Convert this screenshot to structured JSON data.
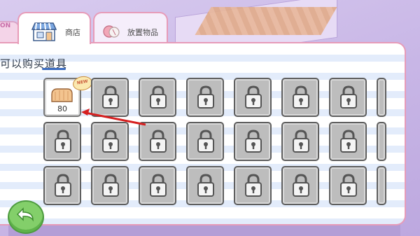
{
  "tabs": [
    {
      "label": "商店",
      "icon": "shop-stall-icon",
      "active": true
    },
    {
      "label": "放置物品",
      "icon": "place-items-icon",
      "active": false
    }
  ],
  "panel": {
    "title": "可以购买道具"
  },
  "items": [
    {
      "state": "unlocked",
      "icon": "bread-icon",
      "price": "80",
      "badge": "NEW"
    },
    {
      "state": "locked"
    },
    {
      "state": "locked"
    },
    {
      "state": "locked"
    },
    {
      "state": "locked"
    },
    {
      "state": "locked"
    },
    {
      "state": "locked"
    },
    {
      "state": "locked"
    },
    {
      "state": "locked"
    },
    {
      "state": "locked"
    },
    {
      "state": "locked"
    },
    {
      "state": "locked"
    },
    {
      "state": "locked"
    },
    {
      "state": "locked"
    },
    {
      "state": "locked"
    },
    {
      "state": "locked"
    },
    {
      "state": "locked"
    },
    {
      "state": "locked"
    },
    {
      "state": "locked"
    },
    {
      "state": "locked"
    },
    {
      "state": "locked"
    }
  ],
  "colors": {
    "accent_border": "#e79bb8",
    "locked_slot": "#bdbdbd",
    "arrow": "#d62020",
    "back_button": "#83cf6a"
  },
  "back_button": {
    "icon": "back-arrow-icon"
  },
  "bg_sign_text": "ON"
}
